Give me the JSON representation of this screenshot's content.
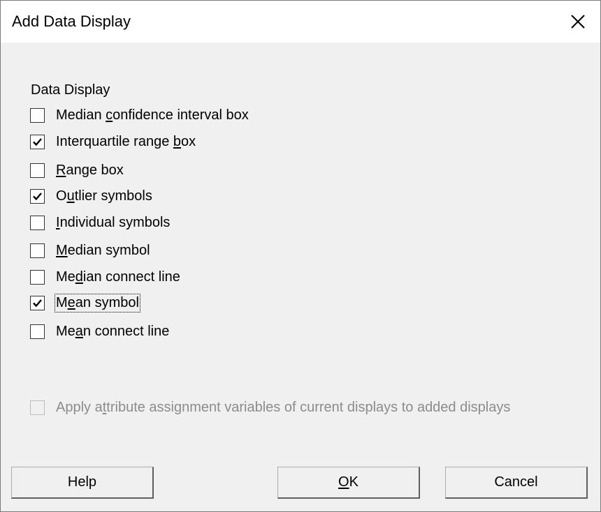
{
  "window": {
    "title": "Add Data Display"
  },
  "section": {
    "label": "Data Display"
  },
  "checkboxes": [
    {
      "pre": "Median ",
      "u": "c",
      "post": "onfidence interval box",
      "checked": false
    },
    {
      "pre": "Interquartile range ",
      "u": "b",
      "post": "ox",
      "checked": true
    },
    {
      "pre": "",
      "u": "R",
      "post": "ange box",
      "checked": false
    },
    {
      "pre": "O",
      "u": "u",
      "post": "tlier symbols",
      "checked": true
    },
    {
      "pre": "",
      "u": "I",
      "post": "ndividual symbols",
      "checked": false
    },
    {
      "pre": "",
      "u": "M",
      "post": "edian symbol",
      "checked": false
    },
    {
      "pre": "Me",
      "u": "d",
      "post": "ian connect line",
      "checked": false
    },
    {
      "pre": "M",
      "u": "e",
      "post": "an symbol",
      "checked": true
    },
    {
      "pre": "Me",
      "u": "a",
      "post": "n connect line",
      "checked": false
    }
  ],
  "apply_option": {
    "pre": "Apply a",
    "u": "t",
    "post": "tribute assignment variables of current displays to added displays",
    "checked": false,
    "enabled": false
  },
  "buttons": {
    "help": "Help",
    "ok_u": "O",
    "ok_post": "K",
    "cancel": "Cancel"
  },
  "icons": {
    "close": "close-icon",
    "check": "checkmark-icon"
  },
  "colors": {
    "title_bg": "#ffffff",
    "dialog_bg": "#f0f0f0",
    "disabled_text": "#8c8c8c"
  }
}
